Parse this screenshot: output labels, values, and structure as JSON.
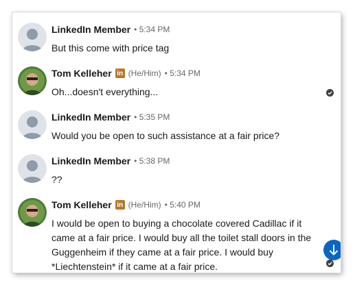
{
  "messages": [
    {
      "sender": "LinkedIn Member",
      "time": "• 5:34 PM",
      "text": "But this come with price tag",
      "avatar": "default-person-icon"
    },
    {
      "sender": "Tom Kelleher",
      "badge": "in",
      "pronouns": "(He/Him)",
      "time": "• 5:34 PM",
      "text": "Oh...doesn't everything...",
      "avatar": "profile-photo",
      "seen": true
    },
    {
      "sender": "LinkedIn Member",
      "time": "• 5:35 PM",
      "text": "Would you be open to such assistance at a fair price?",
      "avatar": "default-person-icon"
    },
    {
      "sender": "LinkedIn Member",
      "time": "• 5:38 PM",
      "text": "??",
      "avatar": "default-person-icon"
    },
    {
      "sender": "Tom Kelleher",
      "badge": "in",
      "pronouns": "(He/Him)",
      "time": "• 5:40 PM",
      "text": "I would be open to buying a chocolate covered Cadillac if it came at a fair price.  I would buy all the toilet stall doors in the Guggenheim if they came at a fair price.  I would buy *Liechtenstein* if it came at a fair price.",
      "avatar": "profile-photo",
      "seen": true
    }
  ],
  "scroll_button": {
    "icon": "arrow-down-icon"
  },
  "colors": {
    "accent": "#0a66c2",
    "premium_badge": "#b4792e",
    "text": "#191919",
    "meta": "#666666"
  }
}
